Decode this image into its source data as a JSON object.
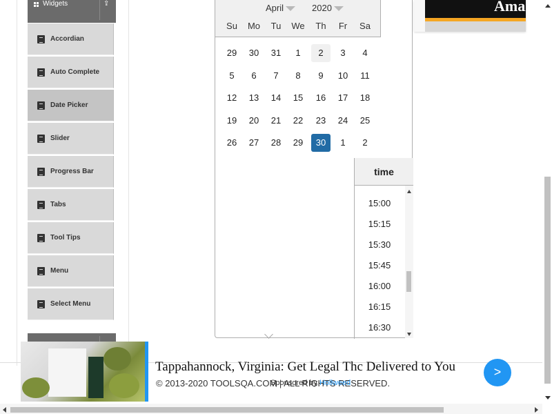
{
  "sidebar": {
    "group_title": "Widgets",
    "items": [
      {
        "label": "Accordian",
        "active": false
      },
      {
        "label": "Auto Complete",
        "active": false
      },
      {
        "label": "Date Picker",
        "active": true
      },
      {
        "label": "Slider",
        "active": false
      },
      {
        "label": "Progress Bar",
        "active": false
      },
      {
        "label": "Tabs",
        "active": false
      },
      {
        "label": "Tool Tips",
        "active": false
      },
      {
        "label": "Menu",
        "active": false
      },
      {
        "label": "Select Menu",
        "active": false
      }
    ]
  },
  "datepicker": {
    "month": "April",
    "year": "2020",
    "weekdays": [
      "Su",
      "Mo",
      "Tu",
      "We",
      "Th",
      "Fr",
      "Sa"
    ],
    "weeks": [
      [
        "29",
        "30",
        "31",
        "1",
        "2",
        "3",
        "4"
      ],
      [
        "5",
        "6",
        "7",
        "8",
        "9",
        "10",
        "11"
      ],
      [
        "12",
        "13",
        "14",
        "15",
        "16",
        "17",
        "18"
      ],
      [
        "19",
        "20",
        "21",
        "22",
        "23",
        "24",
        "25"
      ],
      [
        "26",
        "27",
        "28",
        "29",
        "30",
        "1",
        "2"
      ]
    ],
    "selected_day": "30",
    "keyboard_day": "2",
    "time_header": "time",
    "times": [
      "15:00",
      "15:15",
      "15:30",
      "15:45",
      "16:00",
      "16:15",
      "16:30"
    ]
  },
  "top_ad": {
    "brand": "Amaz"
  },
  "footer": {
    "copyright": "© 2013-2020 TOOLSQA.COM | ALL RIGHTS RESERVED."
  },
  "bottom_ad": {
    "headline": "Tappahannock, Virginia: Get Legal Thc Delivered to You",
    "sponsored_by": "Sponsored by",
    "sponsor_name": "Hollweed",
    "go_button": ">"
  },
  "colors": {
    "accent": "#216ba5",
    "ad_blue": "#2196f3",
    "sidebar_item": "#d9d9d9",
    "sidebar_active": "#c4c4c4"
  }
}
